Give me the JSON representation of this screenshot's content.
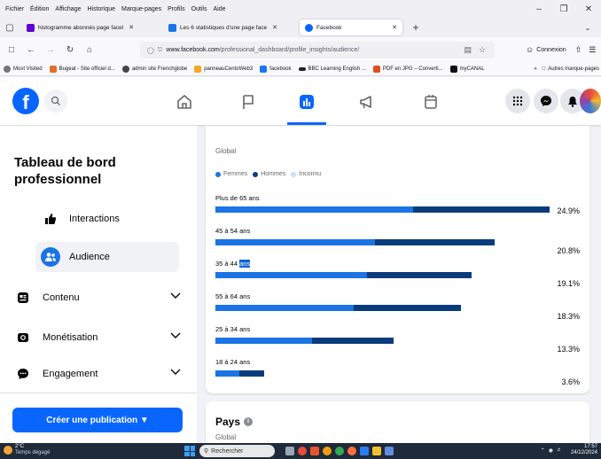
{
  "browser": {
    "menu": [
      "Fichier",
      "Édition",
      "Affichage",
      "Historique",
      "Marque-pages",
      "Profils",
      "Outils",
      "Aide"
    ],
    "tabs": [
      {
        "label": "histogramme abonnés page facel",
        "icon": "yahoo-icon",
        "color": "#6001d2",
        "active": false
      },
      {
        "label": "Les 6 statistiques d'une page face",
        "icon": "site-icon",
        "color": "#1a73e8",
        "active": false
      },
      {
        "label": "Facebook",
        "icon": "facebook-icon",
        "color": "#0866ff",
        "active": true
      }
    ],
    "url_domain": "www.facebook.com",
    "url_path": "/professional_dashboard/profile_insights/audience/",
    "connexion": "Connexion",
    "bookmarks": [
      "Most Visited",
      "Bugeat - Site officiel d...",
      "admin site Frenchglobe",
      "panneauCentoWeb3",
      "facebook",
      "BBC Learning English ...",
      "PDF en JPG – Converti...",
      "myCANAL"
    ],
    "other_bookmarks": "Autres marque-pages"
  },
  "sidebar": {
    "title": "Tableau de bord professionnel",
    "sub_items": [
      {
        "label": "Interactions",
        "icon": "thumbs-up-icon"
      },
      {
        "label": "Audience",
        "icon": "people-icon"
      }
    ],
    "items": [
      {
        "label": "Contenu",
        "icon": "content-icon"
      },
      {
        "label": "Monétisation",
        "icon": "money-icon"
      },
      {
        "label": "Engagement",
        "icon": "chat-bubble-icon"
      }
    ],
    "create_button": "Créer une publication ▼"
  },
  "main": {
    "global_label": "Global",
    "legend": [
      "Femmes",
      "Hommes",
      "Inconnu"
    ],
    "pays_title": "Pays",
    "pays_global": "Global"
  },
  "chart_data": {
    "type": "bar",
    "orientation": "horizontal",
    "stacked": true,
    "categories": [
      "Plus de 65 ans",
      "45 à 54 ans",
      "35 à 44 ans",
      "55 à 64 ans",
      "25 à 34 ans",
      "18 à 24 ans"
    ],
    "value_labels": [
      "24.9%",
      "20.8%",
      "19.1%",
      "18.3%",
      "13.3%",
      "3.6%"
    ],
    "totals": [
      24.9,
      20.8,
      19.1,
      18.3,
      13.3,
      3.6
    ],
    "series": [
      {
        "name": "Femmes",
        "values": [
          14.7,
          11.9,
          11.3,
          10.3,
          7.2,
          1.8
        ]
      },
      {
        "name": "Hommes",
        "values": [
          10.2,
          8.9,
          7.8,
          8.0,
          6.1,
          1.8
        ]
      },
      {
        "name": "Inconnu",
        "values": [
          0,
          0,
          0,
          0,
          0,
          0
        ]
      }
    ],
    "colors": {
      "Femmes": "#1b74e4",
      "Hommes": "#0a3c7c",
      "Inconnu": "#c9dffb"
    },
    "xlim": [
      0,
      24.9
    ]
  },
  "taskbar": {
    "temp": "2°C",
    "weather": "Temps dégagé",
    "search": "Rechercher",
    "time": "17:57",
    "date": "24/12/2024"
  }
}
